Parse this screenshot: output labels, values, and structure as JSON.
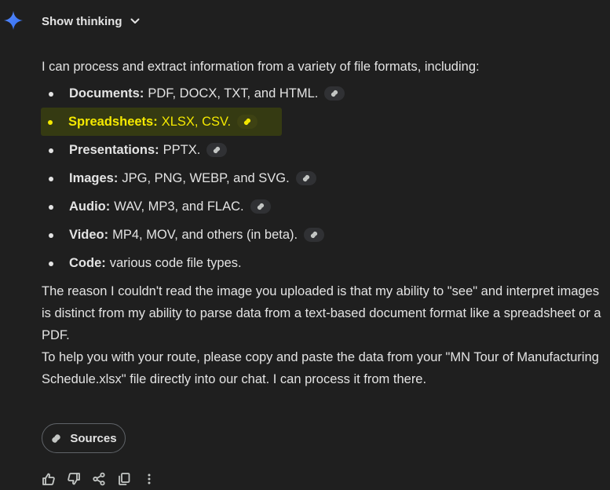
{
  "header": {
    "show_thinking_label": "Show thinking"
  },
  "response": {
    "intro": "I can process and extract information from a variety of file formats, including:",
    "formats": [
      {
        "label": "Documents:",
        "text": "PDF, DOCX, TXT, and HTML.",
        "has_citation": true,
        "highlighted": false
      },
      {
        "label": "Spreadsheets:",
        "text": "XLSX, CSV.",
        "has_citation": true,
        "highlighted": true
      },
      {
        "label": "Presentations:",
        "text": "PPTX.",
        "has_citation": true,
        "highlighted": false
      },
      {
        "label": "Images:",
        "text": "JPG, PNG, WEBP, and SVG.",
        "has_citation": true,
        "highlighted": false
      },
      {
        "label": "Audio:",
        "text": "WAV, MP3, and FLAC.",
        "has_citation": true,
        "highlighted": false
      },
      {
        "label": "Video:",
        "text": "MP4, MOV, and others (in beta).",
        "has_citation": true,
        "highlighted": false
      },
      {
        "label": "Code:",
        "text": "various code file types.",
        "has_citation": false,
        "highlighted": false
      }
    ],
    "paragraph_1": "The reason I couldn't read the image you uploaded is that my ability to \"see\" and interpret images is distinct from my ability to parse data from a text-based document format like a spreadsheet or a PDF.",
    "paragraph_2": "To help you with your route, please copy and paste the data from your \"MN Tour of Manufacturing Schedule.xlsx\" file directly into our chat. I can process it from there."
  },
  "sources_button": {
    "label": "Sources"
  },
  "action_bar": {
    "icons": [
      "thumbs-up-icon",
      "thumbs-down-icon",
      "share-icon",
      "copy-icon",
      "more-vertical-icon"
    ]
  },
  "colors": {
    "background": "#1f1f1f",
    "text": "#e3e3e3",
    "highlight_text": "#f5e900",
    "highlight_bg": "#353a12",
    "gemini_blue": "#4a8fff"
  }
}
